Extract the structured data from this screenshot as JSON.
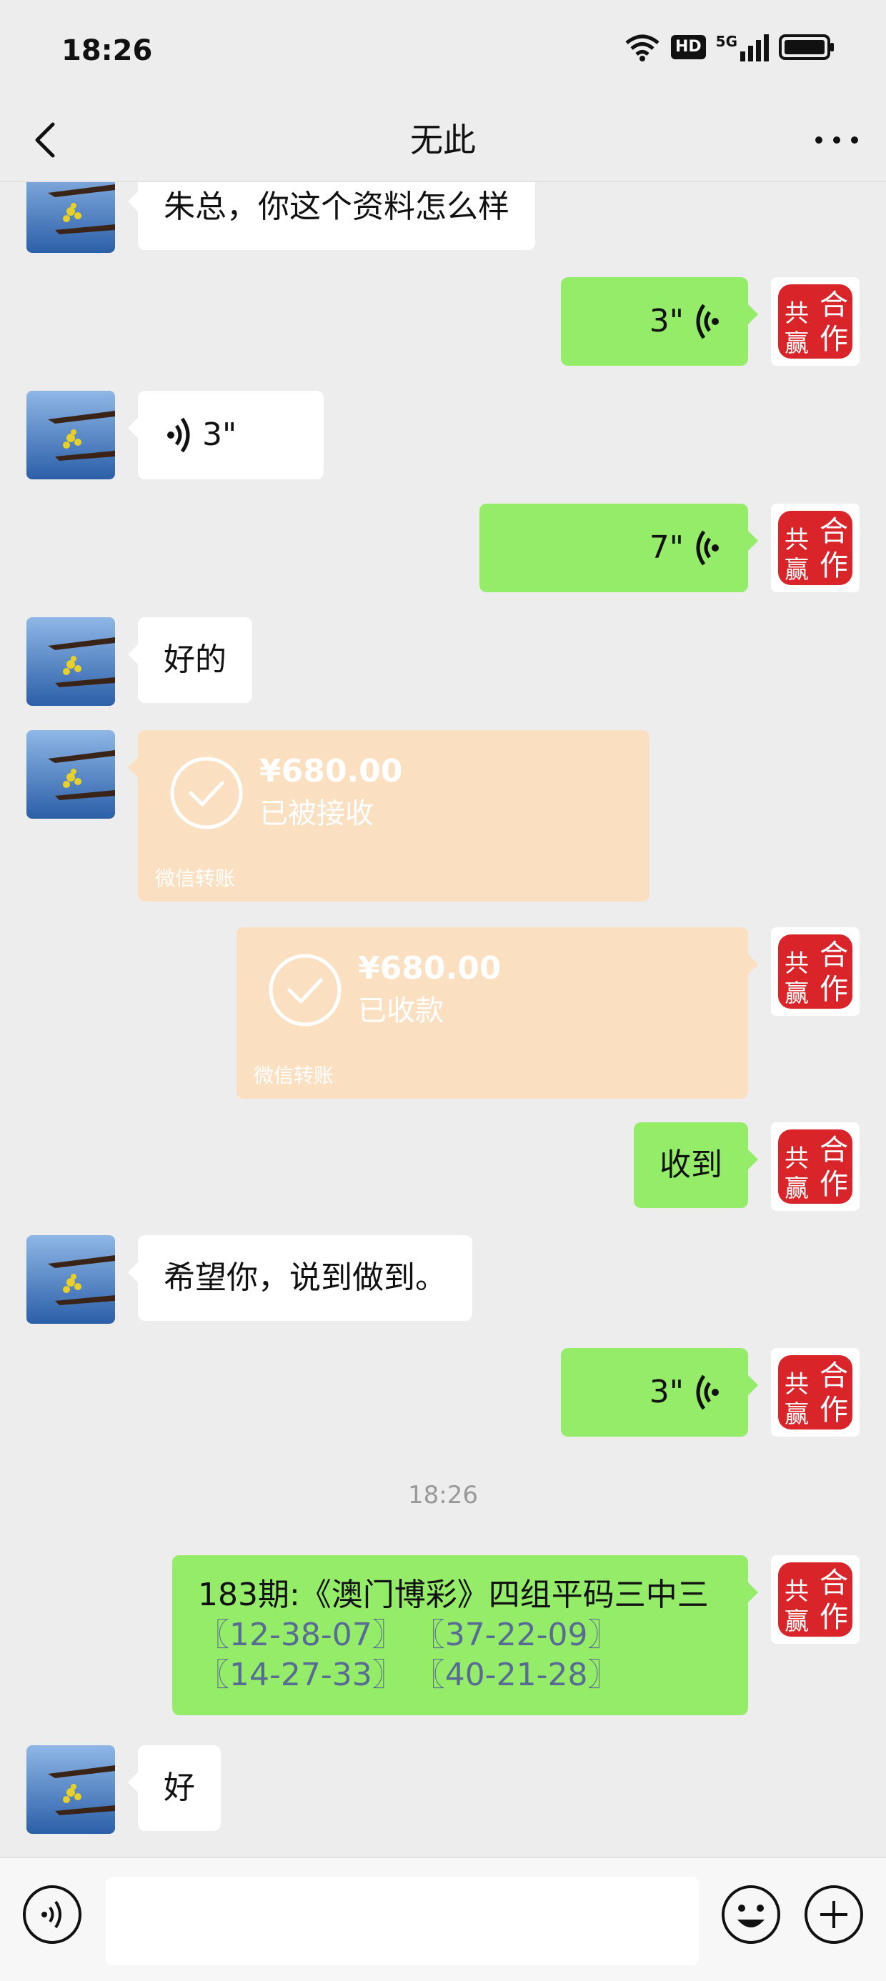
{
  "status_bar": {
    "time": "18:26",
    "hd_label": "HD",
    "network_label": "5G"
  },
  "header": {
    "title": "无此"
  },
  "messages": [
    {
      "side": "in",
      "type": "text",
      "text": "朱总，你这个资料怎么样"
    },
    {
      "side": "out",
      "type": "voice",
      "duration": "3\""
    },
    {
      "side": "in",
      "type": "voice",
      "duration": "3\""
    },
    {
      "side": "out",
      "type": "voice",
      "duration": "7\""
    },
    {
      "side": "in",
      "type": "text",
      "text": "好的"
    },
    {
      "side": "in",
      "type": "transfer",
      "amount": "¥680.00",
      "status": "已被接收",
      "footer": "微信转账"
    },
    {
      "side": "out",
      "type": "transfer",
      "amount": "¥680.00",
      "status": "已收款",
      "footer": "微信转账"
    },
    {
      "side": "out",
      "type": "text",
      "text": "收到"
    },
    {
      "side": "in",
      "type": "text",
      "text": "希望你，说到做到。"
    },
    {
      "side": "out",
      "type": "voice",
      "duration": "3\""
    },
    {
      "type": "timestamp",
      "text": "18:26"
    },
    {
      "side": "out",
      "type": "text",
      "line1": "183期:《澳门博彩》四组平码三中三",
      "line2_a": "〖12-38-07〗",
      "line2_b": "〖37-22-09〗",
      "line3_a": "〖14-27-33〗",
      "line3_b": "〖40-21-28〗"
    },
    {
      "side": "in",
      "type": "text",
      "text": "好"
    }
  ],
  "avatar_right": {
    "seal_text_1": "合",
    "seal_text_2": "作",
    "seal_text_3": "共",
    "seal_text_4": "赢"
  },
  "colors": {
    "background": "#ededed",
    "bubble_out": "#95ec69",
    "bubble_in": "#ffffff",
    "transfer": "#fbdfc1",
    "link": "#576b95"
  }
}
